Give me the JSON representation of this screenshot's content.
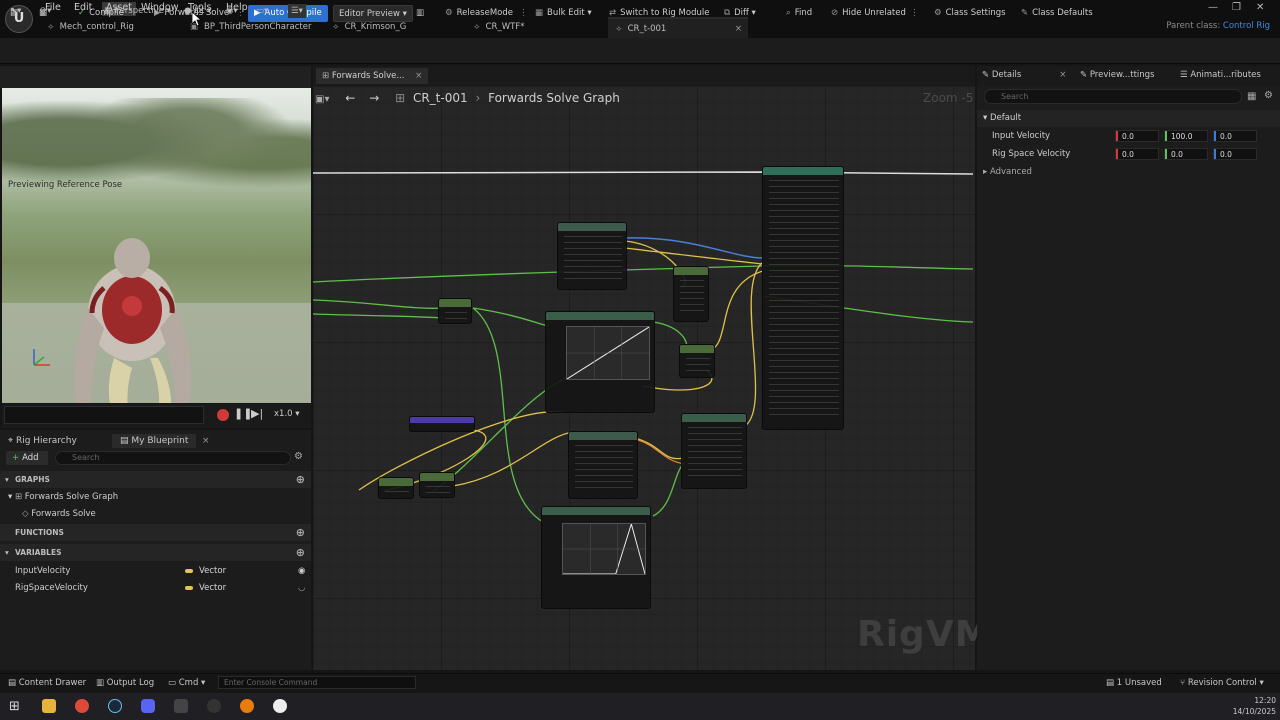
{
  "menu": [
    "File",
    "Edit",
    "Asset",
    "Window",
    "Tools",
    "Help"
  ],
  "tabs": [
    "Mech_control_Rig",
    "BP_ThirdPersonCharacter",
    "CR_Krimson_G",
    "CR_WTF*",
    "CR_t-001"
  ],
  "parent_class_label": "Parent class:",
  "parent_class_value": "Control Rig",
  "toolbar": {
    "compile": "Compile",
    "forwards_solve": "Forwards Solve",
    "auto_compile": "Auto Compile",
    "editor_preview": "Editor Preview",
    "release_mode": "ReleaseMode",
    "bulk_edit": "Bulk Edit",
    "switch_rig": "Switch to Rig Module",
    "diff": "Diff",
    "find": "Find",
    "hide_unrelated": "Hide Unrelated",
    "class_settings": "Class Settings",
    "class_defaults": "Class Defaults"
  },
  "viewport": {
    "perspective": "Perspective",
    "lit": "Lit",
    "label": "Previewing Reference Pose",
    "speed": "x1.0"
  },
  "left_panel": {
    "rig_hierarchy": "Rig Hierarchy",
    "my_blueprint": "My Blueprint",
    "add": "Add",
    "search_placeholder": "Search",
    "graphs_header": "GRAPHS",
    "graph_name": "Forwards Solve Graph",
    "graph_item": "Forwards Solve",
    "functions_header": "FUNCTIONS",
    "variables_header": "VARIABLES",
    "variables": [
      {
        "name": "InputVelocity",
        "type": "Vector"
      },
      {
        "name": "RigSpaceVelocity",
        "type": "Vector"
      }
    ]
  },
  "graph": {
    "tab": "Forwards Solve...",
    "crumb_root": "CR_t-001",
    "crumb_leaf": "Forwards Solve Graph",
    "zoom": "Zoom -5",
    "watermark": "RigVM"
  },
  "details": {
    "tab_details": "Details",
    "tab_preview": "Preview...ttings",
    "tab_anim": "Animati...ributes",
    "search_placeholder": "Search",
    "category": "Default",
    "rows": [
      {
        "label": "Input Velocity",
        "x": "0.0",
        "y": "100.0",
        "z": "0.0"
      },
      {
        "label": "Rig Space Velocity",
        "x": "0.0",
        "y": "0.0",
        "z": "0.0"
      }
    ],
    "advanced": "Advanced"
  },
  "status": {
    "content_drawer": "Content Drawer",
    "output_log": "Output Log",
    "cmd": "Cmd",
    "console_placeholder": "Enter Console Command",
    "unsaved": "1 Unsaved",
    "revision": "Revision Control"
  },
  "clock": {
    "time": "12:20",
    "date": "14/10/2025"
  },
  "colors": {
    "accent": "#2f6fd0",
    "exec_wire": "#e0e0e0",
    "float_wire": "#5ec04a",
    "vector_wire": "#e0c14a",
    "rotation_wire": "#4a7fd6"
  }
}
